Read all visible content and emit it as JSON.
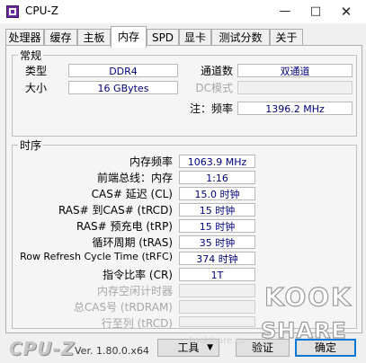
{
  "window": {
    "title": "CPU-Z"
  },
  "tabs": [
    "处理器",
    "缓存",
    "主板",
    "内存",
    "SPD",
    "显卡",
    "测试分数",
    "关于"
  ],
  "general": {
    "title": "常规",
    "type_label": "类型",
    "type_value": "DDR4",
    "size_label": "大小",
    "size_value": "16 GBytes",
    "channels_label": "通道数",
    "channels_value": "双通道",
    "dc_mode_label": "DC模式",
    "dc_mode_value": "",
    "note_label": "注：频率",
    "note_value": "1396.2 MHz"
  },
  "timings": {
    "title": "时序",
    "rows": [
      {
        "label": "内存频率",
        "value": "1063.9 MHz"
      },
      {
        "label": "前端总线：内存",
        "value": "1:16"
      },
      {
        "label": "CAS# 延迟 (CL)",
        "value": "15.0 时钟"
      },
      {
        "label": "RAS# 到CAS# (tRCD)",
        "value": "15 时钟"
      },
      {
        "label": "RAS# 预充电 (tRP)",
        "value": "15 时钟"
      },
      {
        "label": "循环周期 (tRAS)",
        "value": "35 时钟"
      },
      {
        "label": "Row Refresh Cycle Time (tRFC)",
        "value": "374 时钟"
      },
      {
        "label": "指令比率 (CR)",
        "value": "1T"
      },
      {
        "label": "内存空闲计时器",
        "value": ""
      },
      {
        "label": "总CAS号 (tRDRAM)",
        "value": ""
      },
      {
        "label": "行至列 (tRCD)",
        "value": ""
      }
    ]
  },
  "footer": {
    "brand": "CPU-Z",
    "version": "Ver. 1.80.0.x64",
    "tools_label": "工具",
    "validate_label": "验证",
    "ok_label": "确定"
  },
  "watermark": {
    "line1": "KOOK",
    "line2": "SHARE",
    "text": "koolshare.cn"
  }
}
